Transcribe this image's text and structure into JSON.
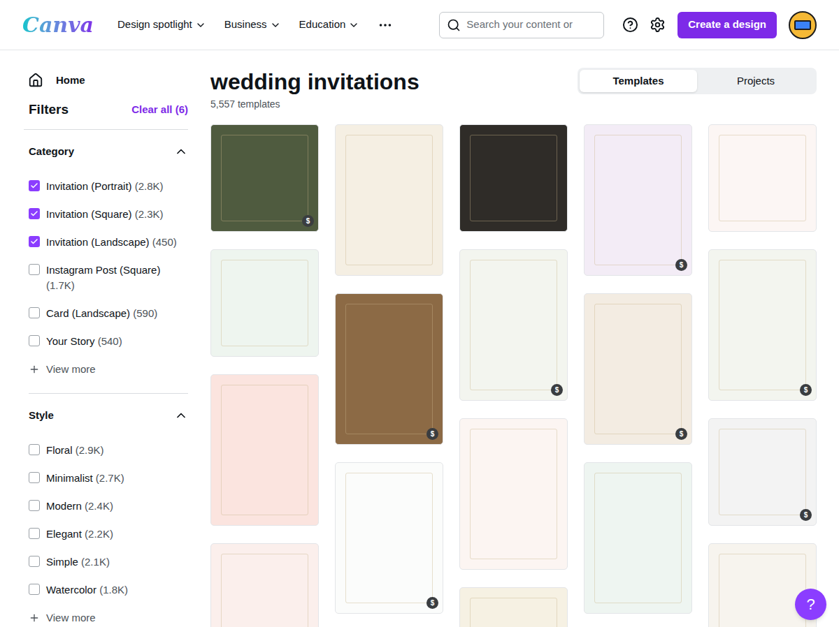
{
  "logo": "Canva",
  "nav": [
    {
      "label": "Design spotlight",
      "has_menu": true
    },
    {
      "label": "Business",
      "has_menu": true
    },
    {
      "label": "Education",
      "has_menu": true
    }
  ],
  "search": {
    "placeholder": "Search your content or"
  },
  "create_button": "Create a design",
  "sidebar": {
    "home": "Home",
    "filters_title": "Filters",
    "clear_all": "Clear all (6)",
    "sections": [
      {
        "title": "Category",
        "expanded": true,
        "view_more": "View more",
        "items": [
          {
            "label": "Invitation (Portrait)",
            "count": "(2.8K)",
            "checked": true
          },
          {
            "label": "Invitation (Square)",
            "count": "(2.3K)",
            "checked": true
          },
          {
            "label": "Invitation (Landscape)",
            "count": "(450)",
            "checked": true
          },
          {
            "label": "Instagram Post (Square)",
            "count": "(1.7K)",
            "checked": false
          },
          {
            "label": "Card (Landscape)",
            "count": "(590)",
            "checked": false
          },
          {
            "label": "Your Story",
            "count": "(540)",
            "checked": false
          }
        ]
      },
      {
        "title": "Style",
        "expanded": true,
        "view_more": "View more",
        "items": [
          {
            "label": "Floral",
            "count": "(2.9K)",
            "checked": false
          },
          {
            "label": "Minimalist",
            "count": "(2.7K)",
            "checked": false
          },
          {
            "label": "Modern",
            "count": "(2.4K)",
            "checked": false
          },
          {
            "label": "Elegant",
            "count": "(2.2K)",
            "checked": false
          },
          {
            "label": "Simple",
            "count": "(2.1K)",
            "checked": false
          },
          {
            "label": "Watercolor",
            "count": "(1.8K)",
            "checked": false
          }
        ]
      }
    ]
  },
  "page": {
    "title": "wedding invitations",
    "count": "5,557 templates"
  },
  "tabs": [
    {
      "label": "Templates",
      "selected": true
    },
    {
      "label": "Projects",
      "selected": false
    }
  ],
  "pro_badge": "$",
  "columns": [
    [
      {
        "kind": "square",
        "pro": true,
        "color": "#4f5b3f"
      },
      {
        "kind": "square",
        "pro": false,
        "color": "#eef5ef"
      },
      {
        "kind": "portrait",
        "pro": false,
        "color": "#fbe4df"
      },
      {
        "kind": "portrait",
        "pro": false,
        "color": "#fbefec"
      }
    ],
    [
      {
        "kind": "portrait",
        "pro": false,
        "color": "#f5efe3"
      },
      {
        "kind": "portrait",
        "pro": true,
        "color": "#8c6a45"
      },
      {
        "kind": "portrait",
        "pro": true,
        "color": "#fbfcfb"
      }
    ],
    [
      {
        "kind": "square",
        "pro": false,
        "color": "#2f2c28"
      },
      {
        "kind": "portrait",
        "pro": true,
        "color": "#f3f5ef"
      },
      {
        "kind": "portrait",
        "pro": false,
        "color": "#fcf5f2"
      },
      {
        "kind": "portrait",
        "pro": false,
        "color": "#f6f1e3"
      }
    ],
    [
      {
        "kind": "portrait",
        "pro": true,
        "color": "#f3ecf6"
      },
      {
        "kind": "portrait",
        "pro": true,
        "color": "#f3ece2"
      },
      {
        "kind": "portrait",
        "pro": false,
        "color": "#eef5f1"
      }
    ],
    [
      {
        "kind": "square",
        "pro": false,
        "color": "#fcf6f4"
      },
      {
        "kind": "portrait",
        "pro": true,
        "color": "#f3f5ef"
      },
      {
        "kind": "square",
        "pro": true,
        "color": "#f3f3f3"
      },
      {
        "kind": "portrait",
        "pro": false,
        "color": "#f7f4ee"
      }
    ]
  ],
  "help_button": "?"
}
